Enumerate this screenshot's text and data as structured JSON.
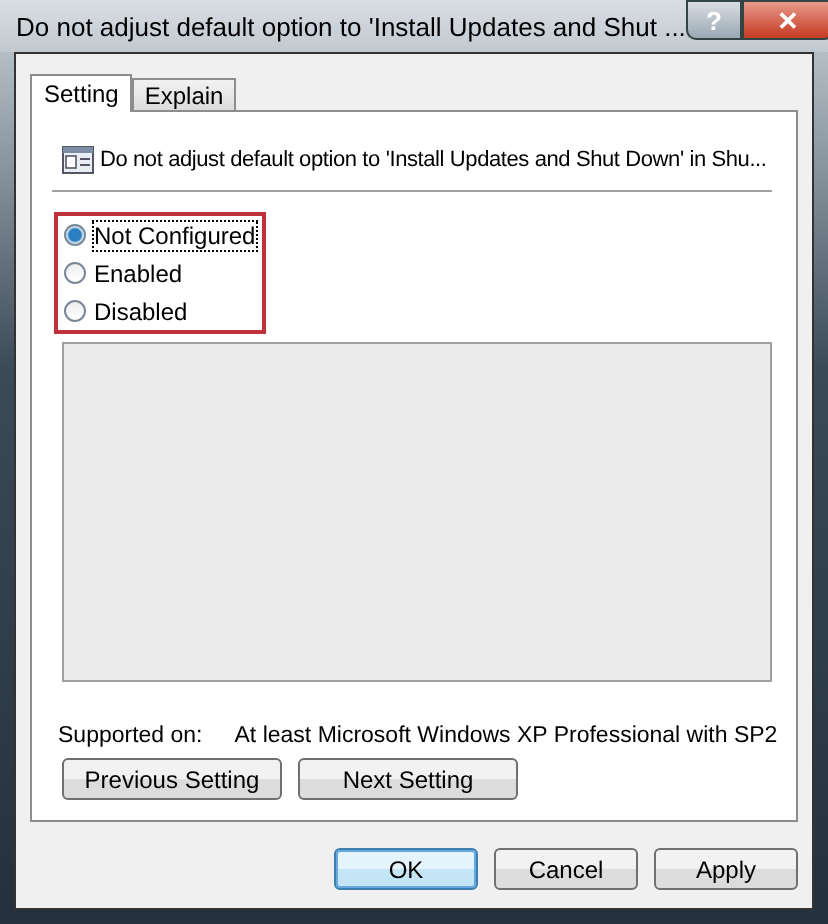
{
  "window": {
    "title": "Do not adjust default option to 'Install Updates and Shut ...",
    "help": "?",
    "close": "✕"
  },
  "tabs": [
    {
      "label": "Setting",
      "selected": true
    },
    {
      "label": "Explain",
      "selected": false
    }
  ],
  "policy_title": "Do not adjust default option to 'Install Updates and Shut Down' in Shu...",
  "options": [
    {
      "label": "Not Configured",
      "selected": true
    },
    {
      "label": "Enabled",
      "selected": false
    },
    {
      "label": "Disabled",
      "selected": false
    }
  ],
  "supported_on": {
    "label": "Supported on:",
    "value": "At least Microsoft Windows XP Professional with SP2"
  },
  "nav_buttons": [
    "Previous Setting",
    "Next Setting"
  ],
  "buttons": [
    {
      "label": "OK",
      "default": true
    },
    {
      "label": "Cancel",
      "default": false
    },
    {
      "label": "Apply",
      "default": false
    }
  ]
}
